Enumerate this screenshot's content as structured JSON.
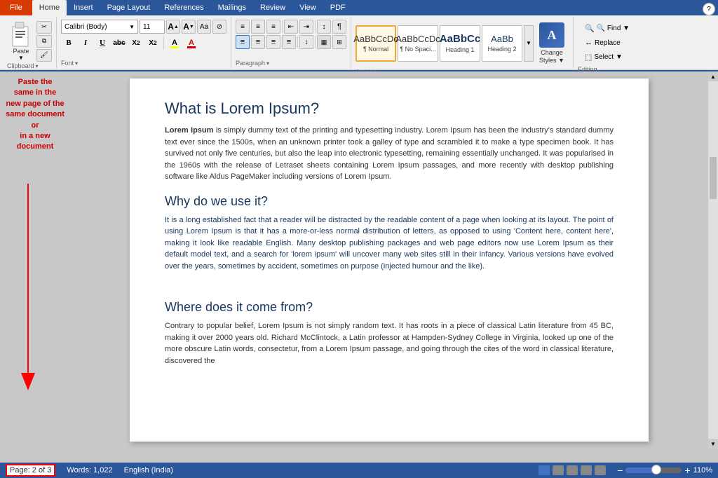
{
  "tabs": {
    "file": "File",
    "home": "Home",
    "insert": "Insert",
    "page_layout": "Page Layout",
    "references": "References",
    "mailings": "Mailings",
    "review": "Review",
    "view": "View",
    "pdf": "PDF"
  },
  "ribbon": {
    "clipboard": {
      "label": "Clipboard",
      "paste": "Paste",
      "cut": "✂",
      "copy": "⧉",
      "painter": "🖌"
    },
    "font": {
      "label": "Font",
      "name": "Calibri (Body)",
      "size": "11",
      "grow": "A",
      "shrink": "A",
      "case": "Aa",
      "clear": "⊘",
      "bold": "B",
      "italic": "I",
      "underline": "U",
      "strike": "ab",
      "sub": "X₂",
      "sup": "X²",
      "highlight": "A",
      "color": "A"
    },
    "paragraph": {
      "label": "Paragraph",
      "bullets": "≡",
      "numbering": "≡",
      "indent_dec": "←",
      "indent_inc": "→",
      "sort": "↕",
      "show_hide": "¶",
      "align_left": "≡",
      "align_center": "≡",
      "align_right": "≡",
      "justify": "≡",
      "line_spacing": "≡",
      "shading": "□",
      "border": "▦"
    },
    "styles": {
      "label": "Styles",
      "normal": {
        "line1": "¶ Normal",
        "badge": "¶ Normal"
      },
      "no_spacing": {
        "line1": "¶ No Spaci..."
      },
      "heading1": "Heading 1",
      "heading2": "Heading 2",
      "change_styles": "Change\nStyles ▼",
      "more": "▼"
    },
    "editing": {
      "label": "Editing",
      "find": "🔍 Find ▼",
      "replace": "Replace",
      "select": "Select ▼"
    }
  },
  "document": {
    "heading1": "What is Lorem Ipsum?",
    "para1_bold": "Lorem Ipsum",
    "para1": " is simply dummy text of the printing and typesetting industry. Lorem Ipsum has been the industry's standard dummy text ever since the 1500s, when an unknown printer took a galley of type and scrambled it to make a type specimen book. It has survived not only five centuries, but also the leap into electronic typesetting, remaining essentially unchanged. It was popularised in the 1960s with the release of Letraset sheets containing Lorem Ipsum passages, and more recently with desktop publishing software like Aldus PageMaker including versions of Lorem Ipsum.",
    "heading2": "Why do we use it?",
    "para2": "It is a long established fact that a reader will be distracted by the readable content of a page when looking at its layout. The point of using Lorem Ipsum is that it has a more-or-less normal distribution of letters, as opposed to using 'Content here, content here', making it look like readable English. Many desktop publishing packages and web page editors now use Lorem Ipsum as their default model text, and a search for 'lorem ipsum' will uncover many web sites still in their infancy. Various versions have evolved over the years, sometimes by accident, sometimes on purpose (injected humour and the like).",
    "heading3": "Where does it come from?",
    "para3": "Contrary to popular belief, Lorem Ipsum is not simply random text. It has roots in a piece of classical Latin literature from 45 BC, making it over 2000 years old. Richard McClintock, a Latin professor at Hampden-Sydney College in Virginia, looked up one of the more obscure Latin words, consectetur, from a Lorem Ipsum passage, and going through the cites of the word in classical literature, discovered the"
  },
  "annotation": {
    "line1": "Paste the",
    "line2": "same in the",
    "line3": "new page of the",
    "line4": "same document",
    "or": "or",
    "line5": "in a new",
    "line6": "document"
  },
  "status_bar": {
    "page": "Page: 2 of 3",
    "words": "Words: 1,022",
    "language": "English (India)",
    "zoom": "110%"
  }
}
